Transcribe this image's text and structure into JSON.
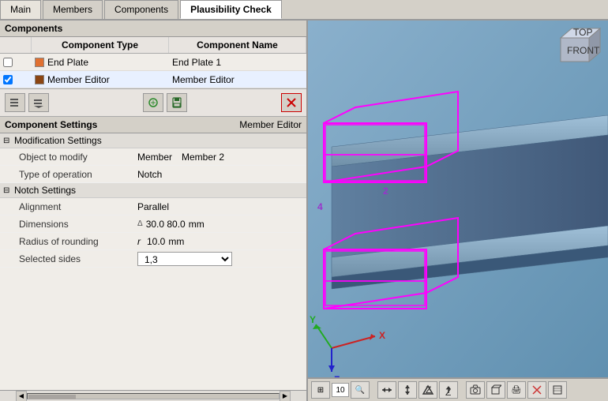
{
  "tabs": [
    {
      "id": "main",
      "label": "Main",
      "active": false
    },
    {
      "id": "members",
      "label": "Members",
      "active": false
    },
    {
      "id": "components",
      "label": "Components",
      "active": false
    },
    {
      "id": "plausibility",
      "label": "Plausibility Check",
      "active": true
    }
  ],
  "left": {
    "components_section": "Components",
    "table": {
      "col_type": "Component Type",
      "col_name": "Component Name",
      "rows": [
        {
          "checked": false,
          "color": "orange",
          "type": "End Plate",
          "name": "End Plate 1"
        },
        {
          "checked": true,
          "color": "brown",
          "type": "Member Editor",
          "name": "Member Editor"
        }
      ]
    },
    "toolbar": {
      "btn_move_left": "◀",
      "btn_move_right": "▶",
      "btn_add": "➕",
      "btn_save": "💾",
      "btn_delete": "✕"
    },
    "settings": {
      "title": "Component Settings",
      "context": "Member Editor",
      "groups": [
        {
          "label": "Modification Settings",
          "expanded": true,
          "rows": [
            {
              "label": "Object to modify",
              "value": "Member",
              "value2": "Member 2"
            },
            {
              "label": "Type of operation",
              "value": "Notch",
              "value2": ""
            }
          ]
        },
        {
          "label": "Notch Settings",
          "expanded": true,
          "rows": [
            {
              "label": "Alignment",
              "value": "Parallel",
              "value2": "",
              "delta": false
            },
            {
              "label": "Dimensions",
              "value": "30.0  80.0",
              "value2": "mm",
              "delta": true
            },
            {
              "label": "Radius of rounding",
              "value": "10.0",
              "value2": "mm",
              "delta": false,
              "prefix": "r"
            },
            {
              "label": "Selected sides",
              "value": "1,3",
              "value2": "",
              "isSelect": true
            }
          ]
        }
      ]
    }
  },
  "viewport": {
    "num_labels": [
      "4",
      "2"
    ],
    "axes": {
      "x": "X",
      "y": "Y",
      "z": "Z"
    }
  },
  "bottom_toolbar": {
    "number": "10",
    "buttons": [
      "⊞",
      "10",
      "🔍",
      "⇔",
      "⇕",
      "⇧",
      "Z⇧",
      "📷",
      "📦",
      "🖨",
      "🚫",
      "📐"
    ]
  }
}
